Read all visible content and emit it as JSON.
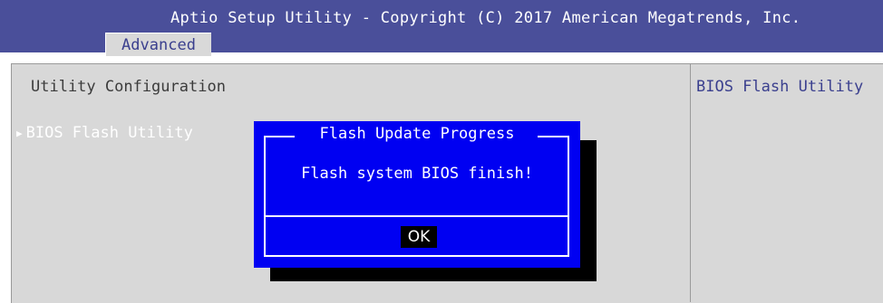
{
  "header": {
    "title": "Aptio Setup Utility - Copyright (C) 2017 American Megatrends, Inc.",
    "active_tab": "Advanced"
  },
  "main": {
    "section_title": "Utility Configuration",
    "items": [
      {
        "label": "BIOS Flash Utility",
        "icon": "right-triangle-icon"
      }
    ]
  },
  "help_panel": {
    "text": "BIOS Flash Utility"
  },
  "dialog": {
    "title": "Flash Update Progress",
    "message": "Flash system BIOS finish!",
    "ok_label": "OK"
  },
  "colors": {
    "header_bg": "#4a4f9a",
    "panel_bg": "#d8d8d8",
    "dialog_bg": "#0000f2",
    "accent_text": "#3a3f8e"
  }
}
